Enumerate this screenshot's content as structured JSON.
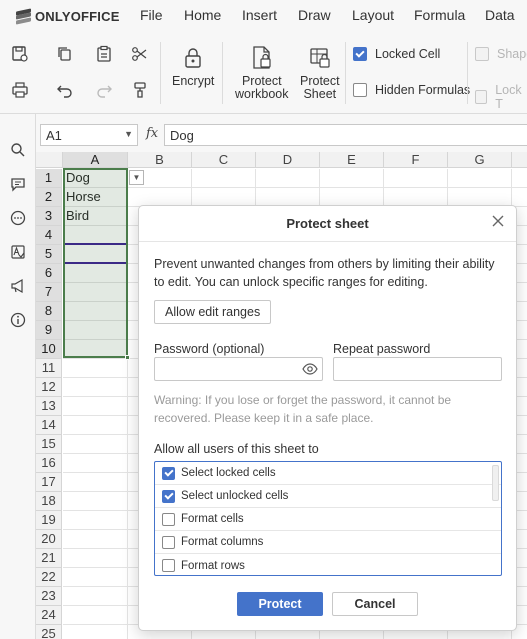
{
  "app": {
    "logo_text": "ONLYOFFICE"
  },
  "menu": [
    "File",
    "Home",
    "Insert",
    "Draw",
    "Layout",
    "Formula",
    "Data"
  ],
  "toolbar": {
    "encrypt_label": "Encrypt",
    "protect_workbook_label_1": "Protect",
    "protect_workbook_label_2": "workbook",
    "protect_sheet_label_1": "Protect",
    "protect_sheet_label_2": "Sheet",
    "locked_cell_label": "Locked Cell",
    "locked_cell_checked": true,
    "hidden_formulas_label": "Hidden Formulas",
    "hidden_formulas_checked": false,
    "shape_label": "Shape",
    "lock_text_label": "Lock T"
  },
  "formula_bar": {
    "name_box": "A1",
    "fx": "fx",
    "value": "Dog"
  },
  "grid": {
    "columns": [
      "A",
      "B",
      "C",
      "D",
      "E",
      "F",
      "G"
    ],
    "rows": [
      "1",
      "2",
      "3",
      "4",
      "5",
      "6",
      "7",
      "8",
      "9",
      "10",
      "11",
      "12",
      "13",
      "14",
      "15",
      "16",
      "17",
      "18",
      "19",
      "20",
      "21",
      "22",
      "23",
      "24",
      "25"
    ],
    "cells_a": [
      "Dog",
      "Horse",
      "Bird"
    ]
  },
  "dialog": {
    "title": "Protect sheet",
    "description": "Prevent unwanted changes from others by limiting their ability to edit. You can unlock specific ranges for editing.",
    "allow_ranges_button": "Allow edit ranges",
    "password_label": "Password (optional)",
    "repeat_password_label": "Repeat password",
    "password_value": "",
    "repeat_password_value": "",
    "warning": "Warning: If you lose or forget the password, it cannot be recovered. Please keep it in a safe place.",
    "allow_label": "Allow all users of this sheet to",
    "permissions": [
      {
        "label": "Select locked cells",
        "checked": true
      },
      {
        "label": "Select unlocked cells",
        "checked": true
      },
      {
        "label": "Format cells",
        "checked": false
      },
      {
        "label": "Format columns",
        "checked": false
      },
      {
        "label": "Format rows",
        "checked": false
      }
    ],
    "protect_button": "Protect",
    "cancel_button": "Cancel",
    "accent_color": "#4473ca"
  }
}
